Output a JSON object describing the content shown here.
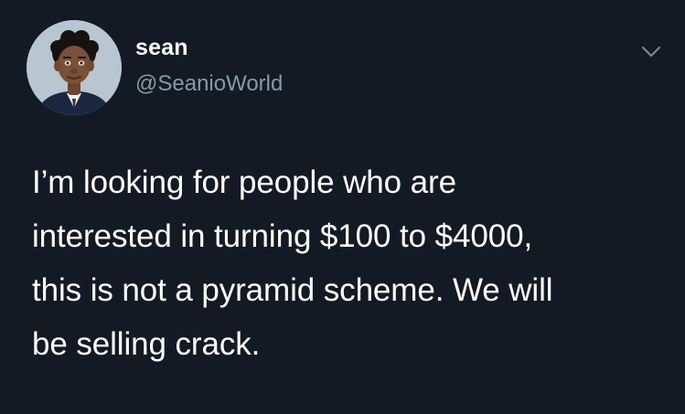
{
  "user": {
    "display_name": "sean",
    "handle": "@SeanioWorld",
    "avatar_icon": "person-avatar-icon"
  },
  "header": {
    "menu_icon": "chevron-down-icon"
  },
  "tweet": {
    "lines": [
      "I’m looking for people who are",
      "interested in turning $100 to $4000,",
      "this is not a pyramid scheme. We will",
      "be selling crack."
    ]
  },
  "colors": {
    "background": "#131a23",
    "primary_text": "#ffffff",
    "secondary_text": "#8899a6"
  }
}
